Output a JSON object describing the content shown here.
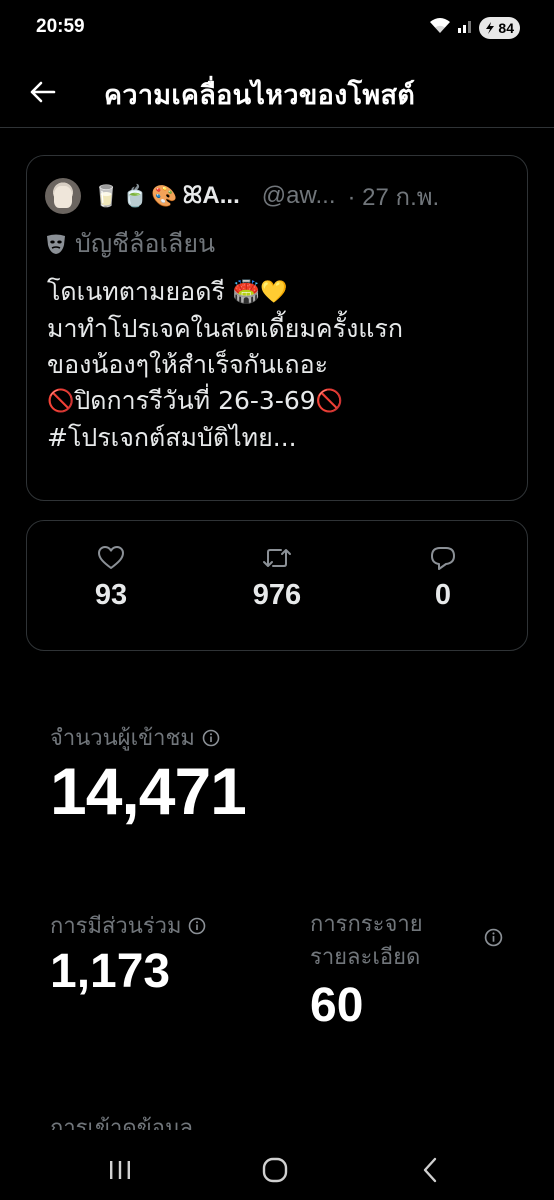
{
  "status_bar": {
    "time": "20:59",
    "battery": "84",
    "icons": [
      "wifi-icon",
      "signal-icon",
      "battery-icon"
    ]
  },
  "header": {
    "title": "ความเคลื่อนไหวของโพสต์",
    "back_icon": "arrow-left-icon"
  },
  "post": {
    "author_emojis": [
      "🥛",
      "🍵",
      "🎨"
    ],
    "display_name": "ꕤA...",
    "handle": "@aw...",
    "date": "· 27 ก.พ.",
    "parody_label": "บัญชีล้อเลียน",
    "lines": [
      {
        "text": "โดเนทตามยอดรี",
        "emoji_after": "🏟️💛"
      },
      {
        "text": "มาทำโปรเจคในสเตเดี้ยมครั้งแรก"
      },
      {
        "text": "ของน้องๆให้สำเร็จกันเถอะ"
      },
      {
        "emoji_before": "🚫",
        "text": "ปิดการรีวันที่ 26-3-69",
        "emoji_after": "🚫"
      },
      {
        "text": "#โปรเจกต์สมบัติไทย..."
      }
    ]
  },
  "engagement": {
    "likes": "93",
    "reposts": "976",
    "replies": "0"
  },
  "metrics": {
    "impressions_label": "จำนวนผู้เข้าชม",
    "impressions_value": "14,471",
    "engagements_label": "การมีส่วนร่วม",
    "engagements_value": "1,173",
    "detail_expands_label_1": "การกระจาย",
    "detail_expands_label_2": "รายละเอียด",
    "detail_expands_value": "60",
    "next_label": "การเข้าดูข้อมูล"
  },
  "colors": {
    "background": "#000000",
    "text": "#e7e9ea",
    "muted": "#71767b",
    "border": "#2f3336"
  }
}
